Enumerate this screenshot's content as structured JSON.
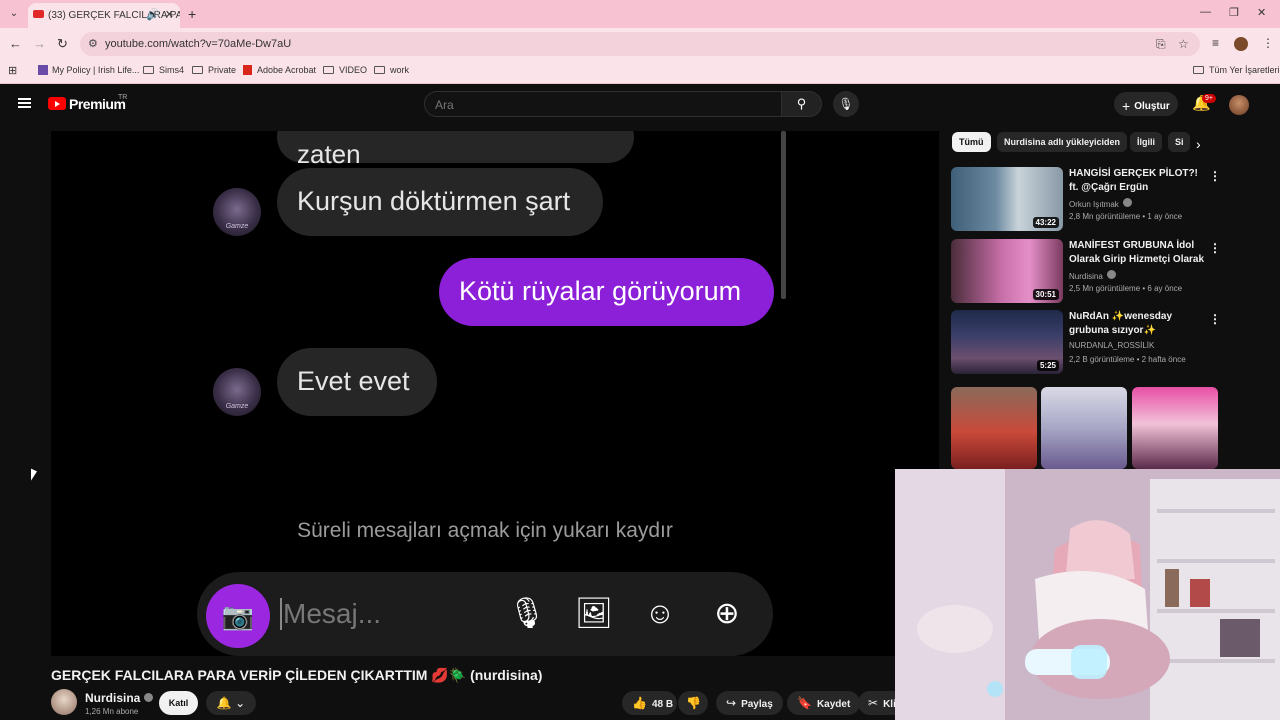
{
  "browser": {
    "tab_title": "(33) GERÇEK FALCILARA PARA",
    "url": "youtube.com/watch?v=70aMe-Dw7aU",
    "bookmarks": [
      {
        "label": "My Policy | Irish Life..."
      },
      {
        "label": "Sims4"
      },
      {
        "label": "Private"
      },
      {
        "label": "Adobe Acrobat"
      },
      {
        "label": "VIDEO"
      },
      {
        "label": "work"
      }
    ],
    "all_bookmarks": "Tüm Yer İşaretleri"
  },
  "header": {
    "logo": "Premium",
    "country": "TR",
    "search_placeholder": "Ara",
    "create_label": "Oluştur",
    "notif_badge": "9+"
  },
  "video": {
    "chat": {
      "top_partial": "zaten",
      "msg1": "Kurşun döktürmen şart",
      "msg2": "Kötü rüyalar görüyorum",
      "msg3": "Evet evet",
      "avatar_label": "Gamze",
      "hint": "Süreli mesajları açmak için yukarı kaydır",
      "composer_placeholder": "Mesaj..."
    },
    "title": "GERÇEK FALCILARA PARA VERİP ÇİLEDEN ÇIKARTTIM 💋🪲 (nurdisina)",
    "channel": "Nurdisina",
    "subscribers": "1,26 Mn abone",
    "join_label": "Katıl",
    "likes": "48 B",
    "share_label": "Paylaş",
    "save_label": "Kaydet",
    "clip_label": "Kli"
  },
  "sidebar": {
    "chips": [
      {
        "label": "Tümü"
      },
      {
        "label": "Nurdisina adlı yükleyiciden"
      },
      {
        "label": "İlgili"
      },
      {
        "label": "Si"
      }
    ],
    "recommendations": [
      {
        "title": "HANGİSİ GERÇEK PİLOT?! ft. @Çağrı Ergün",
        "channel": "Orkun Işıtmak",
        "meta": "2,8 Mn görüntüleme • 1 ay önce",
        "duration": "43:22"
      },
      {
        "title": "MANİFEST GRUBUNA İdol Olarak Girip Hizmetçi Olarak ...",
        "channel": "Nurdisina",
        "meta": "2,5 Mn görüntüleme • 6 ay önce",
        "duration": "30:51"
      },
      {
        "title": "NuRdAn ✨wenesday grubuna sızıyor✨",
        "channel": "NURDANLA_ROSSİLİK",
        "meta": "2,2 B görüntüleme • 2 hafta önce",
        "duration": "5:25"
      }
    ]
  },
  "colors": {
    "yt_bg": "#0f0f0f",
    "accent_red": "#ff0000",
    "purple_bubble": "#8c1fd8",
    "browser_pink": "#f7c3d3"
  }
}
